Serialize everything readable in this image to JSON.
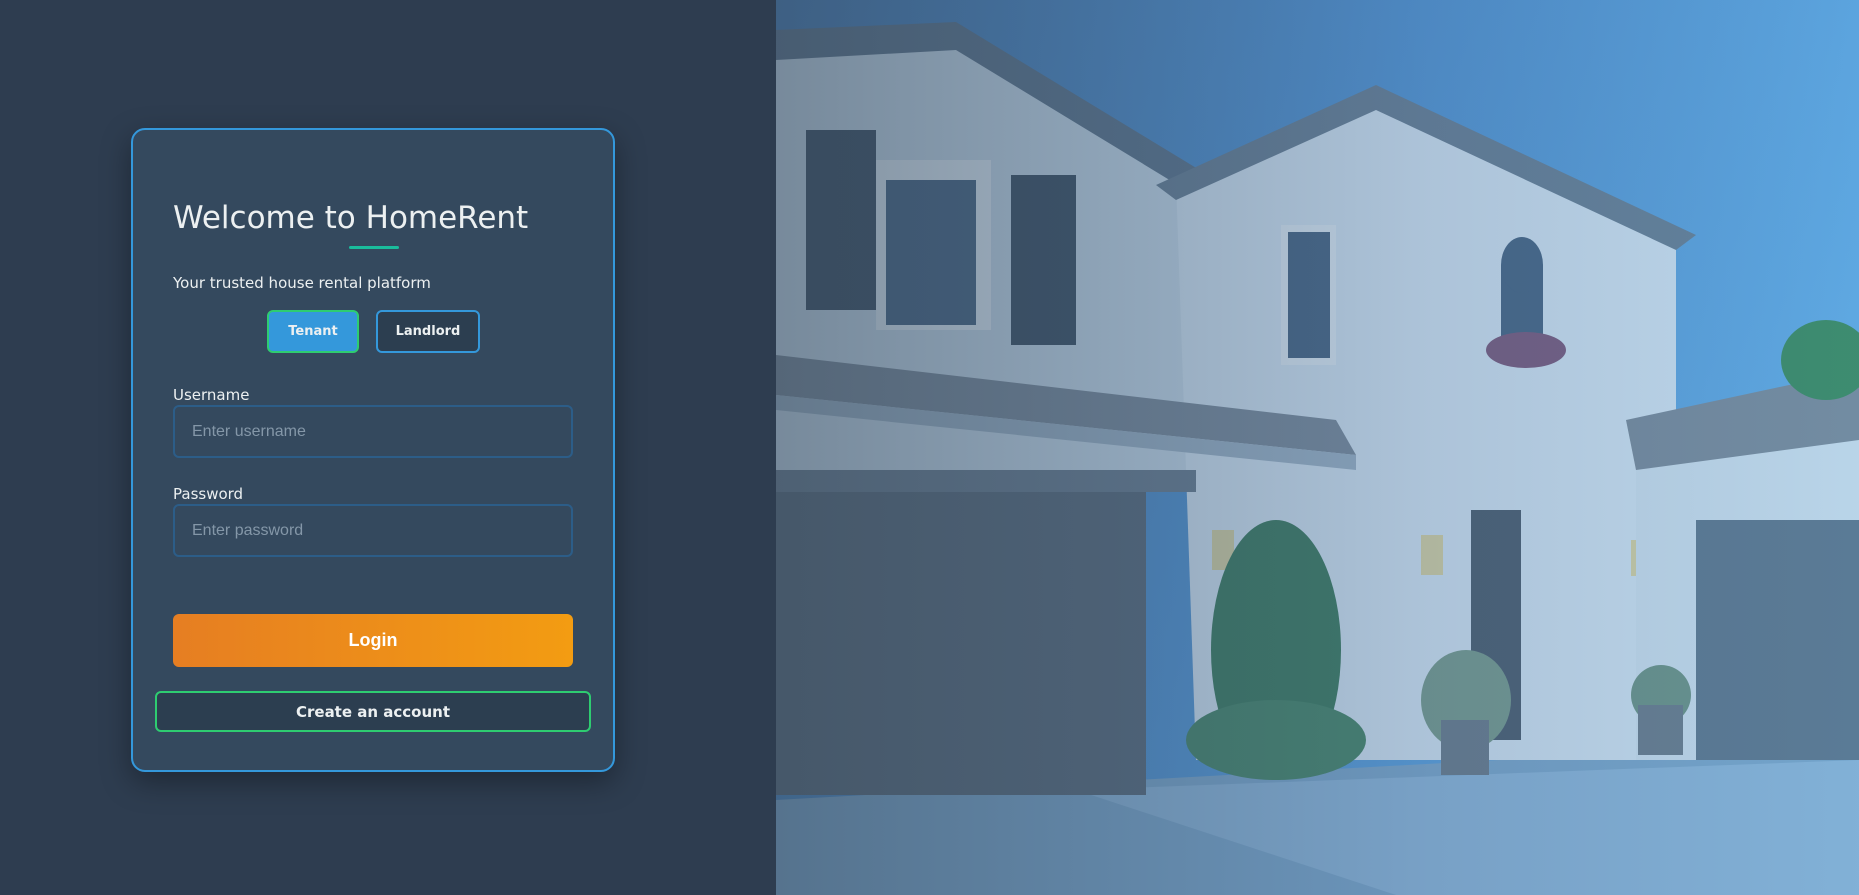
{
  "login": {
    "title": "Welcome to HomeRent",
    "subtitle": "Your trusted house rental platform",
    "roles": [
      {
        "label": "Tenant",
        "selected": true
      },
      {
        "label": "Landlord",
        "selected": false
      }
    ],
    "username": {
      "label": "Username",
      "placeholder": "Enter username",
      "value": ""
    },
    "password": {
      "label": "Password",
      "placeholder": "Enter password",
      "value": ""
    },
    "login_label": "Login",
    "create_account_label": "Create an account"
  },
  "colors": {
    "background": "#2e3d50",
    "card": "#34495e",
    "card_border": "#3498db",
    "accent_green": "#2ecc71",
    "accent_teal": "#1abc9c",
    "login_gradient_start": "#e67e22",
    "login_gradient_end": "#f39c12"
  },
  "hero": {
    "image_subject": "house-photo",
    "icon": "house-image"
  }
}
